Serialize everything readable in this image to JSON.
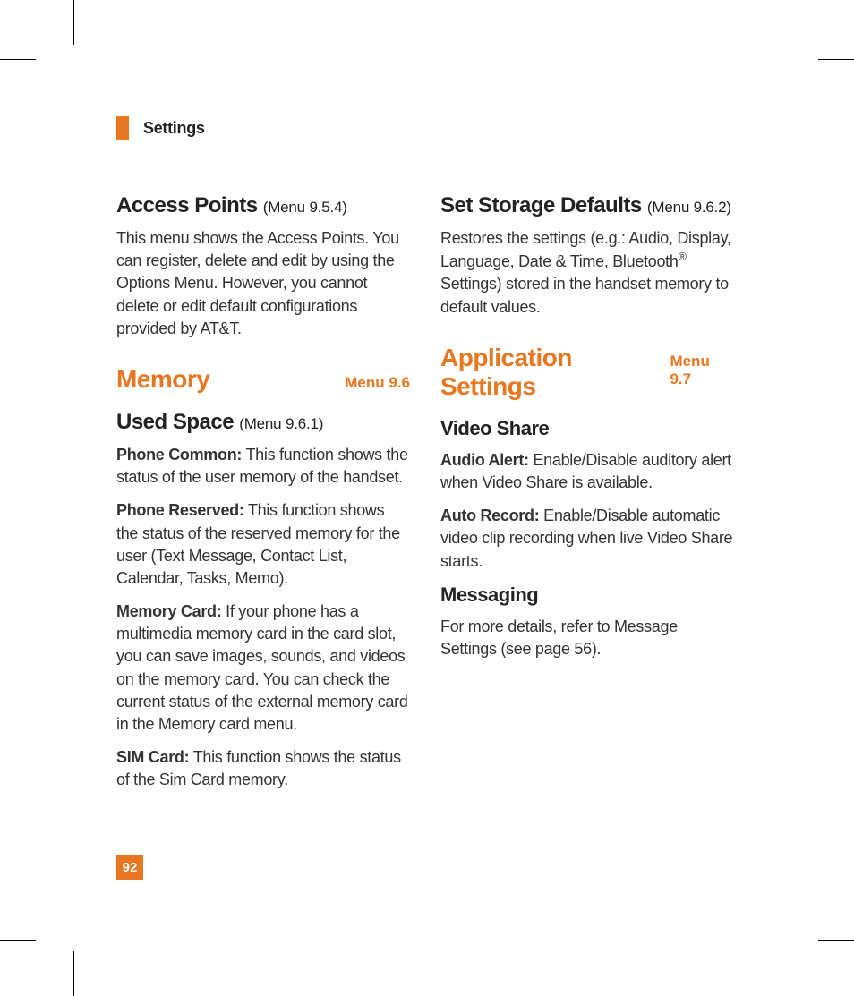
{
  "header": {
    "title": "Settings"
  },
  "left": {
    "access_points": {
      "title": "Access Points",
      "menu": "(Menu 9.5.4)",
      "body": "This menu shows the Access Points. You can register, delete and edit by using the Options Menu. However, you cannot delete or edit default configurations provided by AT&T."
    },
    "memory": {
      "title": "Memory",
      "menu": "Menu 9.6",
      "used_space": {
        "title": "Used Space",
        "menu": "(Menu 9.6.1)"
      },
      "phone_common": {
        "label": "Phone Common:",
        "body": " This function shows the status of the user memory of the handset."
      },
      "phone_reserved": {
        "label": "Phone Reserved:",
        "body": " This function shows the status of the reserved memory for the user (Text Message, Contact List, Calendar, Tasks, Memo)."
      },
      "memory_card": {
        "label": "Memory Card:",
        "body": " If your phone has a multimedia memory card in the card slot, you can save images, sounds, and videos on the memory card. You can check the current status of the external memory card in the Memory card menu."
      },
      "sim_card": {
        "label": "SIM Card:",
        "body": " This function shows the status of the Sim Card memory."
      }
    }
  },
  "right": {
    "storage_defaults": {
      "title": "Set Storage Defaults",
      "menu": "(Menu 9.6.2)",
      "body_pre": "Restores the settings (e.g.: Audio, Display, Language, Date & Time, Bluetooth",
      "body_post": " Settings) stored in the handset memory to default values."
    },
    "app_settings": {
      "title": "Application Settings",
      "menu": "Menu 9.7",
      "video_share": {
        "title": "Video Share"
      },
      "audio_alert": {
        "label": "Audio Alert:",
        "body": " Enable/Disable auditory alert when Video Share is available."
      },
      "auto_record": {
        "label": "Auto Record:",
        "body": " Enable/Disable automatic video clip recording when live Video Share starts."
      },
      "messaging": {
        "title": "Messaging",
        "body": "For more details, refer to Message Settings (see page 56)."
      }
    }
  },
  "page_number": "92"
}
